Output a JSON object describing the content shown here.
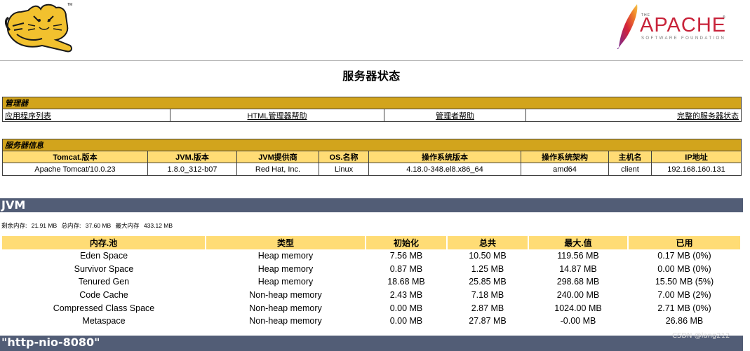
{
  "title": "服务器状态",
  "manager": {
    "section": "管理器",
    "links": [
      "应用程序列表",
      "HTML管理器帮助",
      "管理者帮助",
      "完整的服务器状态"
    ]
  },
  "server_info": {
    "section": "服务器信息",
    "headers": [
      "Tomcat.版本",
      "JVM.版本",
      "JVM提供商",
      "OS.名称",
      "操作系统版本",
      "操作系统架构",
      "主机名",
      "IP地址"
    ],
    "values": [
      "Apache Tomcat/10.0.23",
      "1.8.0_312-b07",
      "Red Hat, Inc.",
      "Linux",
      "4.18.0-348.el8.x86_64",
      "amd64",
      "client",
      "192.168.160.131"
    ]
  },
  "jvm": {
    "heading": "JVM",
    "free_label": "剩余内存:",
    "free_value": "21.91 MB",
    "total_label": "总内存:",
    "total_value": "37.60 MB",
    "max_label": "最大内存",
    "max_value": "433.12 MB"
  },
  "memory_pools": {
    "headers": [
      "内存.池",
      "类型",
      "初始化",
      "总共",
      "最大.值",
      "已用"
    ],
    "rows": [
      [
        "Eden Space",
        "Heap memory",
        "7.56 MB",
        "10.50 MB",
        "119.56 MB",
        "0.17 MB (0%)"
      ],
      [
        "Survivor Space",
        "Heap memory",
        "0.87 MB",
        "1.25 MB",
        "14.87 MB",
        "0.00 MB (0%)"
      ],
      [
        "Tenured Gen",
        "Heap memory",
        "18.68 MB",
        "25.85 MB",
        "298.68 MB",
        "15.50 MB (5%)"
      ],
      [
        "Code Cache",
        "Non-heap memory",
        "2.43 MB",
        "7.18 MB",
        "240.00 MB",
        "7.00 MB (2%)"
      ],
      [
        "Compressed Class Space",
        "Non-heap memory",
        "0.00 MB",
        "2.87 MB",
        "1024.00 MB",
        "2.71 MB (0%)"
      ],
      [
        "Metaspace",
        "Non-heap memory",
        "0.00 MB",
        "27.87 MB",
        "-0.00 MB",
        "26.86 MB"
      ]
    ]
  },
  "connector": {
    "heading": "\"http-nio-8080\""
  },
  "logos": {
    "apache_small": "THE",
    "apache_big": "APACHE",
    "apache_sub": "SOFTWARE FOUNDATION",
    "tm": "TM"
  },
  "watermark": "CSDN @lang212",
  "colors": {
    "section": "#d2a41c",
    "header": "#ffdc75",
    "band": "#525d76"
  }
}
